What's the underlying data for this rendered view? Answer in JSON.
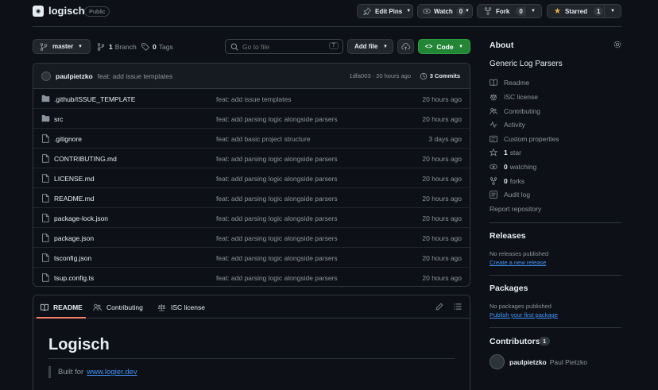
{
  "repo": {
    "name": "logisch",
    "visibility": "Public"
  },
  "header": {
    "edit_pins": "Edit Pins",
    "watch": {
      "label": "Watch",
      "count": "0"
    },
    "fork": {
      "label": "Fork",
      "count": "0"
    },
    "star": {
      "label": "Starred",
      "count": "1"
    }
  },
  "toolbar": {
    "branch": "master",
    "branches_count": "1",
    "branches_label": "Branch",
    "tags_count": "0",
    "tags_label": "Tags",
    "search_placeholder": "Go to file",
    "search_shortcut": "T",
    "add_file": "Add file",
    "code": "Code"
  },
  "commit": {
    "author": "paulpietzko",
    "message": "feat: add issue templates",
    "hash_time": "1dfa003 · 20 hours ago",
    "commits_count": "3",
    "commits_label": "Commits"
  },
  "files": [
    {
      "name": ".github/ISSUE_TEMPLATE",
      "type": "folder",
      "message": "feat: add issue templates",
      "time": "20 hours ago"
    },
    {
      "name": "src",
      "type": "folder",
      "message": "feat: add parsing logic alongside parsers",
      "time": "20 hours ago"
    },
    {
      "name": ".gitignore",
      "type": "file",
      "message": "feat: add basic project structure",
      "time": "3 days ago"
    },
    {
      "name": "CONTRIBUTING.md",
      "type": "file",
      "message": "feat: add parsing logic alongside parsers",
      "time": "20 hours ago"
    },
    {
      "name": "LICENSE.md",
      "type": "file",
      "message": "feat: add parsing logic alongside parsers",
      "time": "20 hours ago"
    },
    {
      "name": "README.md",
      "type": "file",
      "message": "feat: add parsing logic alongside parsers",
      "time": "20 hours ago"
    },
    {
      "name": "package-lock.json",
      "type": "file",
      "message": "feat: add parsing logic alongside parsers",
      "time": "20 hours ago"
    },
    {
      "name": "package.json",
      "type": "file",
      "message": "feat: add parsing logic alongside parsers",
      "time": "20 hours ago"
    },
    {
      "name": "tsconfig.json",
      "type": "file",
      "message": "feat: add parsing logic alongside parsers",
      "time": "20 hours ago"
    },
    {
      "name": "tsup.config.ts",
      "type": "file",
      "message": "feat: add parsing logic alongside parsers",
      "time": "20 hours ago"
    }
  ],
  "readme": {
    "tabs": [
      "README",
      "Contributing",
      "ISC license"
    ],
    "title": "Logisch",
    "quote_prefix": "Built for",
    "quote_link": "www.logier.dev"
  },
  "about": {
    "title": "About",
    "description": "Generic Log Parsers",
    "links": {
      "readme": "Readme",
      "license": "ISC license",
      "contributing": "Contributing",
      "activity": "Activity",
      "custom": "Custom properties",
      "stars_count": "1",
      "stars_label": "star",
      "watching_count": "0",
      "watching_label": "watching",
      "forks_count": "0",
      "forks_label": "forks",
      "audit": "Audit log"
    },
    "report": "Report repository"
  },
  "releases": {
    "title": "Releases",
    "none": "No releases published",
    "create": "Create a new release"
  },
  "packages": {
    "title": "Packages",
    "none": "No packages published",
    "publish": "Publish your first package"
  },
  "contributors": {
    "title": "Contributors",
    "count": "1",
    "login": "paulpietzko",
    "name": "Paul Pietzko"
  },
  "colors": {
    "bg": "#0d1117",
    "border": "#30363d",
    "accent": "#238636",
    "link": "#4493f8",
    "star": "#e3b341"
  }
}
